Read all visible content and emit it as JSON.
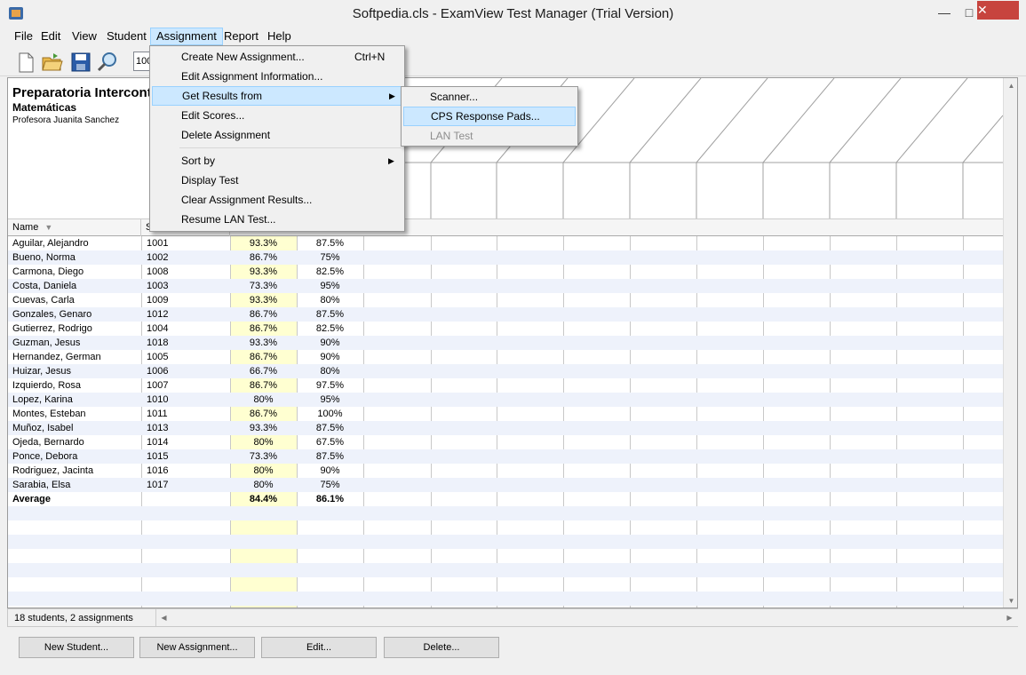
{
  "window": {
    "title": "Softpedia.cls - ExamView Test Manager (Trial Version)",
    "minimize_glyph": "—",
    "maximize_glyph": "□",
    "close_glyph": "✕"
  },
  "menubar": [
    "File",
    "Edit",
    "View",
    "Student",
    "Assignment",
    "Report",
    "Help"
  ],
  "toolbar": {
    "zoom_value": "100"
  },
  "class_info": {
    "title": "Preparatoria Intercontinental",
    "subject": "Matemáticas",
    "teacher": "Profesora Juanita Sanchez"
  },
  "columns": {
    "name": "Name",
    "id": "S"
  },
  "students": [
    {
      "name": "Aguilar, Alejandro",
      "id": "1001",
      "a1": "93.3%",
      "a2": "87.5%"
    },
    {
      "name": "Bueno, Norma",
      "id": "1002",
      "a1": "86.7%",
      "a2": "75%"
    },
    {
      "name": "Carmona, Diego",
      "id": "1008",
      "a1": "93.3%",
      "a2": "82.5%"
    },
    {
      "name": "Costa, Daniela",
      "id": "1003",
      "a1": "73.3%",
      "a2": "95%"
    },
    {
      "name": "Cuevas, Carla",
      "id": "1009",
      "a1": "93.3%",
      "a2": "80%"
    },
    {
      "name": "Gonzales, Genaro",
      "id": "1012",
      "a1": "86.7%",
      "a2": "87.5%"
    },
    {
      "name": "Gutierrez, Rodrigo",
      "id": "1004",
      "a1": "86.7%",
      "a2": "82.5%"
    },
    {
      "name": "Guzman, Jesus",
      "id": "1018",
      "a1": "93.3%",
      "a2": "90%"
    },
    {
      "name": "Hernandez, German",
      "id": "1005",
      "a1": "86.7%",
      "a2": "90%"
    },
    {
      "name": "Huizar, Jesus",
      "id": "1006",
      "a1": "66.7%",
      "a2": "80%"
    },
    {
      "name": "Izquierdo, Rosa",
      "id": "1007",
      "a1": "86.7%",
      "a2": "97.5%"
    },
    {
      "name": "Lopez, Karina",
      "id": "1010",
      "a1": "80%",
      "a2": "95%"
    },
    {
      "name": "Montes, Esteban",
      "id": "1011",
      "a1": "86.7%",
      "a2": "100%"
    },
    {
      "name": "Muñoz, Isabel",
      "id": "1013",
      "a1": "93.3%",
      "a2": "87.5%"
    },
    {
      "name": "Ojeda, Bernardo",
      "id": "1014",
      "a1": "80%",
      "a2": "67.5%"
    },
    {
      "name": "Ponce, Debora",
      "id": "1015",
      "a1": "73.3%",
      "a2": "87.5%"
    },
    {
      "name": "Rodriguez, Jacinta",
      "id": "1016",
      "a1": "80%",
      "a2": "90%"
    },
    {
      "name": "Sarabia, Elsa",
      "id": "1017",
      "a1": "80%",
      "a2": "75%"
    }
  ],
  "average": {
    "label": "Average",
    "a1": "84.4%",
    "a2": "86.1%"
  },
  "status": "18 students, 2 assignments",
  "buttons": {
    "new_student": "New Student...",
    "new_assignment": "New Assignment...",
    "edit": "Edit...",
    "delete": "Delete..."
  },
  "assignment_menu": {
    "create": "Create New Assignment...",
    "create_shortcut": "Ctrl+N",
    "edit_info": "Edit Assignment Information...",
    "get_results": "Get Results from",
    "edit_scores": "Edit Scores...",
    "delete": "Delete Assignment",
    "sort_by": "Sort by",
    "display_test": "Display Test",
    "clear_results": "Clear Assignment Results...",
    "resume_lan": "Resume LAN Test..."
  },
  "submenu": {
    "scanner": "Scanner...",
    "cps": "CPS Response Pads...",
    "lan": "LAN Test"
  },
  "colors": {
    "highlight": "#cce8ff",
    "yellow_column": "#ffffcc",
    "row_alt": "#eef2fb"
  }
}
